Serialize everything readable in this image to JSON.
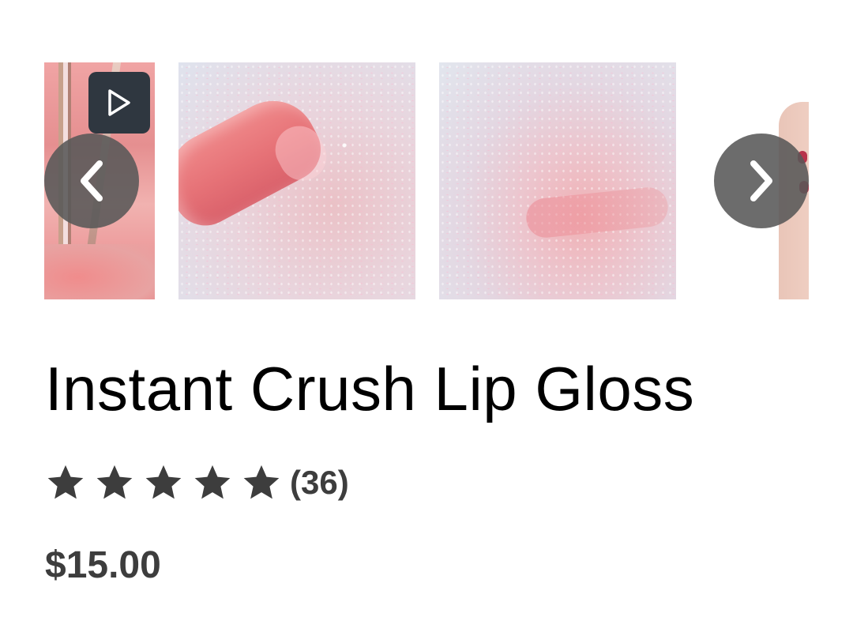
{
  "product": {
    "title": "Instant Crush Lip Gloss",
    "rating": {
      "stars_filled": 5,
      "stars_total": 5,
      "review_count_text": "(36)"
    },
    "price": "$15.00"
  },
  "carousel": {
    "images": [
      {
        "description_icon": "product-tube-image",
        "has_video": true
      },
      {
        "description_icon": "swatch-applicator-image",
        "has_video": false
      },
      {
        "description_icon": "swatch-image",
        "has_video": false
      },
      {
        "description_icon": "hand-holding-product-image",
        "has_video": false
      }
    ],
    "video_icon": "play-icon",
    "prev_icon": "chevron-left-icon",
    "next_icon": "chevron-right-icon"
  },
  "colors": {
    "star": "#3d3d3d",
    "text_secondary": "#3d3d3d",
    "nav_button_bg": "#585858",
    "video_badge_bg": "#2f3740"
  }
}
